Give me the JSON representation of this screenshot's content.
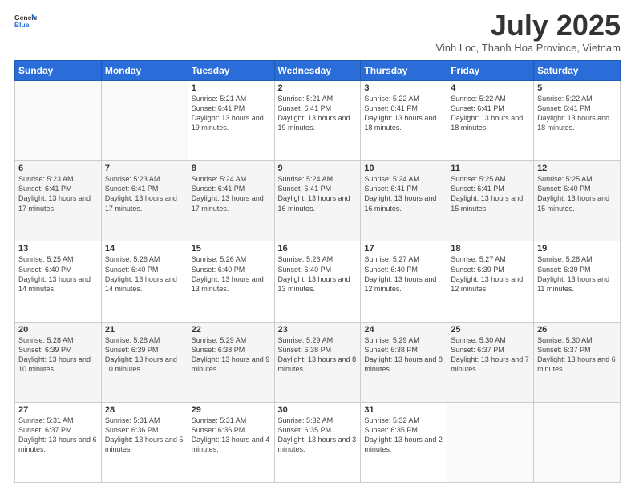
{
  "logo": {
    "line1": "General",
    "line2": "Blue"
  },
  "title": "July 2025",
  "subtitle": "Vinh Loc, Thanh Hoa Province, Vietnam",
  "days_of_week": [
    "Sunday",
    "Monday",
    "Tuesday",
    "Wednesday",
    "Thursday",
    "Friday",
    "Saturday"
  ],
  "weeks": [
    [
      {
        "day": "",
        "info": ""
      },
      {
        "day": "",
        "info": ""
      },
      {
        "day": "1",
        "sunrise": "5:21 AM",
        "sunset": "6:41 PM",
        "daylight": "13 hours and 19 minutes."
      },
      {
        "day": "2",
        "sunrise": "5:21 AM",
        "sunset": "6:41 PM",
        "daylight": "13 hours and 19 minutes."
      },
      {
        "day": "3",
        "sunrise": "5:22 AM",
        "sunset": "6:41 PM",
        "daylight": "13 hours and 18 minutes."
      },
      {
        "day": "4",
        "sunrise": "5:22 AM",
        "sunset": "6:41 PM",
        "daylight": "13 hours and 18 minutes."
      },
      {
        "day": "5",
        "sunrise": "5:22 AM",
        "sunset": "6:41 PM",
        "daylight": "13 hours and 18 minutes."
      }
    ],
    [
      {
        "day": "6",
        "sunrise": "5:23 AM",
        "sunset": "6:41 PM",
        "daylight": "13 hours and 17 minutes."
      },
      {
        "day": "7",
        "sunrise": "5:23 AM",
        "sunset": "6:41 PM",
        "daylight": "13 hours and 17 minutes."
      },
      {
        "day": "8",
        "sunrise": "5:24 AM",
        "sunset": "6:41 PM",
        "daylight": "13 hours and 17 minutes."
      },
      {
        "day": "9",
        "sunrise": "5:24 AM",
        "sunset": "6:41 PM",
        "daylight": "13 hours and 16 minutes."
      },
      {
        "day": "10",
        "sunrise": "5:24 AM",
        "sunset": "6:41 PM",
        "daylight": "13 hours and 16 minutes."
      },
      {
        "day": "11",
        "sunrise": "5:25 AM",
        "sunset": "6:41 PM",
        "daylight": "13 hours and 15 minutes."
      },
      {
        "day": "12",
        "sunrise": "5:25 AM",
        "sunset": "6:40 PM",
        "daylight": "13 hours and 15 minutes."
      }
    ],
    [
      {
        "day": "13",
        "sunrise": "5:25 AM",
        "sunset": "6:40 PM",
        "daylight": "13 hours and 14 minutes."
      },
      {
        "day": "14",
        "sunrise": "5:26 AM",
        "sunset": "6:40 PM",
        "daylight": "13 hours and 14 minutes."
      },
      {
        "day": "15",
        "sunrise": "5:26 AM",
        "sunset": "6:40 PM",
        "daylight": "13 hours and 13 minutes."
      },
      {
        "day": "16",
        "sunrise": "5:26 AM",
        "sunset": "6:40 PM",
        "daylight": "13 hours and 13 minutes."
      },
      {
        "day": "17",
        "sunrise": "5:27 AM",
        "sunset": "6:40 PM",
        "daylight": "13 hours and 12 minutes."
      },
      {
        "day": "18",
        "sunrise": "5:27 AM",
        "sunset": "6:39 PM",
        "daylight": "13 hours and 12 minutes."
      },
      {
        "day": "19",
        "sunrise": "5:28 AM",
        "sunset": "6:39 PM",
        "daylight": "13 hours and 11 minutes."
      }
    ],
    [
      {
        "day": "20",
        "sunrise": "5:28 AM",
        "sunset": "6:39 PM",
        "daylight": "13 hours and 10 minutes."
      },
      {
        "day": "21",
        "sunrise": "5:28 AM",
        "sunset": "6:39 PM",
        "daylight": "13 hours and 10 minutes."
      },
      {
        "day": "22",
        "sunrise": "5:29 AM",
        "sunset": "6:38 PM",
        "daylight": "13 hours and 9 minutes."
      },
      {
        "day": "23",
        "sunrise": "5:29 AM",
        "sunset": "6:38 PM",
        "daylight": "13 hours and 8 minutes."
      },
      {
        "day": "24",
        "sunrise": "5:29 AM",
        "sunset": "6:38 PM",
        "daylight": "13 hours and 8 minutes."
      },
      {
        "day": "25",
        "sunrise": "5:30 AM",
        "sunset": "6:37 PM",
        "daylight": "13 hours and 7 minutes."
      },
      {
        "day": "26",
        "sunrise": "5:30 AM",
        "sunset": "6:37 PM",
        "daylight": "13 hours and 6 minutes."
      }
    ],
    [
      {
        "day": "27",
        "sunrise": "5:31 AM",
        "sunset": "6:37 PM",
        "daylight": "13 hours and 6 minutes."
      },
      {
        "day": "28",
        "sunrise": "5:31 AM",
        "sunset": "6:36 PM",
        "daylight": "13 hours and 5 minutes."
      },
      {
        "day": "29",
        "sunrise": "5:31 AM",
        "sunset": "6:36 PM",
        "daylight": "13 hours and 4 minutes."
      },
      {
        "day": "30",
        "sunrise": "5:32 AM",
        "sunset": "6:35 PM",
        "daylight": "13 hours and 3 minutes."
      },
      {
        "day": "31",
        "sunrise": "5:32 AM",
        "sunset": "6:35 PM",
        "daylight": "13 hours and 2 minutes."
      },
      {
        "day": "",
        "info": ""
      },
      {
        "day": "",
        "info": ""
      }
    ]
  ],
  "labels": {
    "sunrise": "Sunrise:",
    "sunset": "Sunset:",
    "daylight": "Daylight:"
  }
}
